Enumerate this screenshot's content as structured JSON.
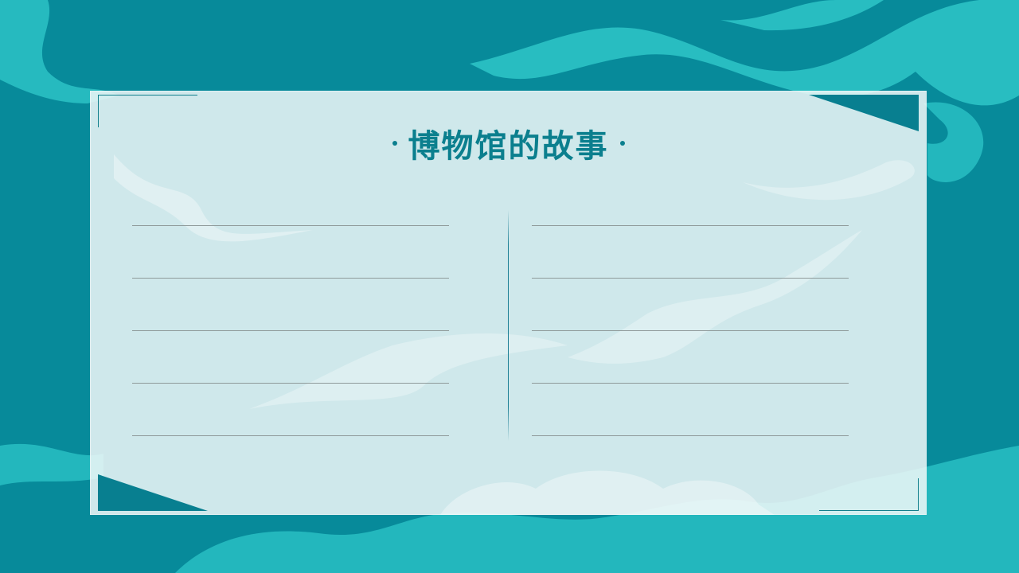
{
  "card": {
    "title": "博物馆的故事"
  },
  "theme": {
    "background": "#078a9a",
    "accent": "#0b7f8e",
    "cloud": "#2cc6c9",
    "line_color": "#8f9a9a"
  },
  "left_column": {
    "lines": 5
  },
  "right_column": {
    "lines": 5
  }
}
